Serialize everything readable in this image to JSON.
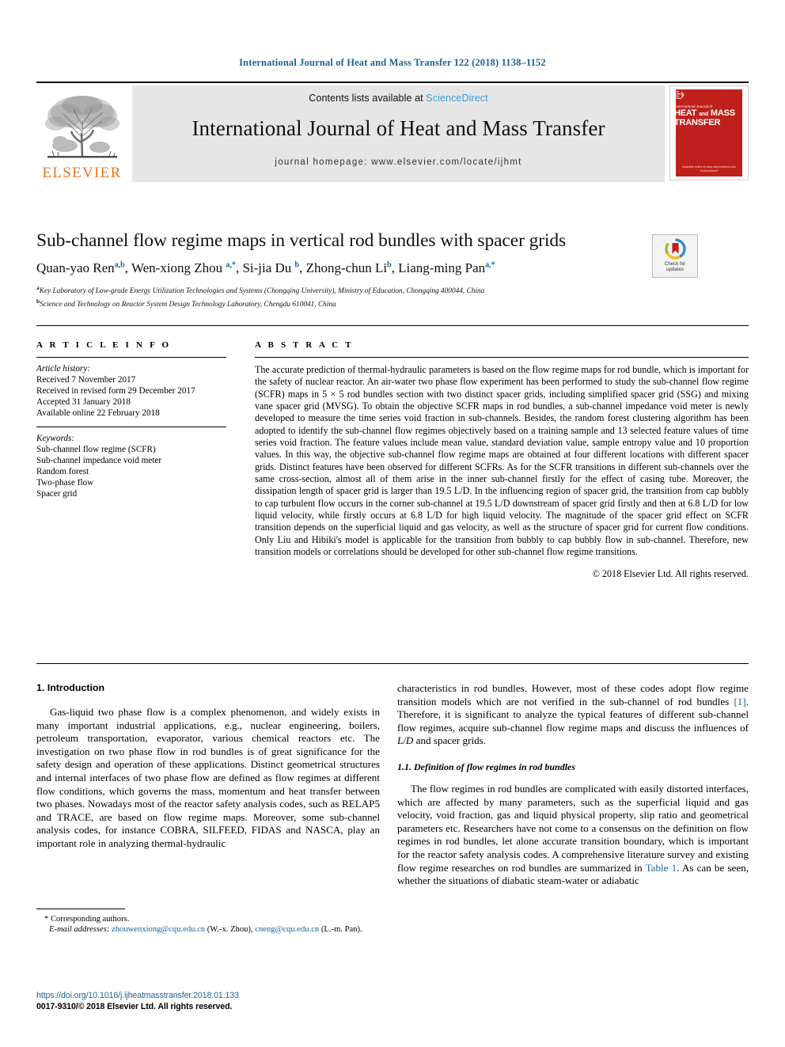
{
  "running_head": "International Journal of Heat and Mass Transfer 122 (2018) 1138–1152",
  "masthead": {
    "contents_prefix": "Contents lists available at ",
    "sciencedirect": "ScienceDirect",
    "journal_title": "International Journal of Heat and Mass Transfer",
    "journal_homepage": "journal homepage: www.elsevier.com/locate/ijhmt",
    "publisher": "ELSEVIER",
    "cover": {
      "line_small": "International Journal of",
      "line_big_1": "HEAT",
      "line_big_and": "and",
      "line_big_2": "MASS",
      "line_big_3": "TRANSFER",
      "footer_1": "Available online at www.sciencedirect.com",
      "footer_2": "ScienceDirect"
    },
    "accent_blue": "#3A9FD6",
    "elsevier_orange": "#E87722",
    "cover_red": "#c0201c"
  },
  "article": {
    "title": "Sub-channel flow regime maps in vertical rod bundles with spacer grids",
    "authors": [
      {
        "name": "Quan-yao Ren",
        "sup": "a,b"
      },
      {
        "name": "Wen-xiong Zhou",
        "sup": "a,*"
      },
      {
        "name": "Si-jia Du",
        "sup": "b"
      },
      {
        "name": "Zhong-chun Li",
        "sup": "b"
      },
      {
        "name": "Liang-ming Pan",
        "sup": "a,*"
      }
    ],
    "affiliations": [
      {
        "marker": "a",
        "text": "Key Laboratory of Low-grade Energy Utilization Technologies and Systems (Chongqing University), Ministry of Education, Chongqing 400044, China"
      },
      {
        "marker": "b",
        "text": "Science and Technology on Reactor System Design Technology Laboratory, Chengdu 610041, China"
      }
    ],
    "crossmark_label_line1": "Check for",
    "crossmark_label_line2": "updates"
  },
  "article_info": {
    "heading": "A R T I C L E   I N F O",
    "history_heading": "Article history:",
    "history": [
      "Received 7 November 2017",
      "Received in revised form 29 December 2017",
      "Accepted 31 January 2018",
      "Available online 22 February 2018"
    ],
    "keywords_heading": "Keywords:",
    "keywords": [
      "Sub-channel flow regime (SCFR)",
      "Sub-channel impedance void meter",
      "Random forest",
      "Two-phase flow",
      "Spacer grid"
    ]
  },
  "abstract": {
    "heading": "A B S T R A C T",
    "text": "The accurate prediction of thermal-hydraulic parameters is based on the flow regime maps for rod bundle, which is important for the safety of nuclear reactor. An air-water two phase flow experiment has been performed to study the sub-channel flow regime (SCFR) maps in 5 × 5 rod bundles section with two distinct spacer grids, including simplified spacer grid (SSG) and mixing vane spacer grid (MVSG). To obtain the objective SCFR maps in rod bundles, a sub-channel impedance void meter is newly developed to measure the time series void fraction in sub-channels. Besides, the random forest clustering algorithm has been adopted to identify the sub-channel flow regimes objectively based on a training sample and 13 selected feature values of time series void fraction. The feature values include mean value, standard deviation value, sample entropy value and 10 proportion values. In this way, the objective sub-channel flow regime maps are obtained at four different locations with different spacer grids. Distinct features have been observed for different SCFRs. As for the SCFR transitions in different sub-channels over the same cross-section, almost all of them arise in the inner sub-channel firstly for the effect of casing tube. Moreover, the dissipation length of spacer grid is larger than 19.5 L/D. In the influencing region of spacer grid, the transition from cap bubbly to cap turbulent flow occurs in the corner sub-channel at 19.5 L/D downstream of spacer grid firstly and then at 6.8 L/D for low liquid velocity, while firstly occurs at 6.8 L/D for high liquid velocity. The magnitude of the spacer grid effect on SCFR transition depends on the superficial liquid and gas velocity, as well as the structure of spacer grid for current flow conditions. Only Liu and Hibiki's model is applicable for the transition from bubbly to cap bubbly flow in sub-channel. Therefore, new transition models or correlations should be developed for other sub-channel flow regime transitions.",
    "copyright": "© 2018 Elsevier Ltd. All rights reserved."
  },
  "body": {
    "section1_heading": "1. Introduction",
    "section1_para1_left": "Gas-liquid two phase flow is a complex phenomenon, and widely exists in many important industrial applications, e.g., nuclear engineering, boilers, petroleum transportation, evaporator, various chemical reactors etc. The investigation on two phase flow in rod bundles is of great significance for the safety design and operation of these applications. Distinct geometrical structures and internal interfaces of two phase flow are defined as flow regimes at different flow conditions, which governs the mass, momentum and heat transfer between two phases. Nowadays most of the reactor safety analysis codes, such as RELAP5 and TRACE, are based on flow regime maps. Moreover, some sub-channel analysis codes, for instance COBRA, SILFEED, FIDAS and NASCA, play an important role in analyzing thermal-hydraulic",
    "section1_para1_right_a": "characteristics in rod bundles. However, most of these codes adopt flow regime transition models which are not verified in the sub-channel of rod bundles ",
    "ref_1": "[1]",
    "section1_para1_right_b": ". Therefore, it is significant to analyze the typical features of different sub-channel flow regimes, acquire sub-channel flow regime maps and discuss the influences of ",
    "ld_italic": "L/D",
    "section1_para1_right_c": " and spacer grids.",
    "section11_heading": "1.1. Definition of flow regimes in rod bundles",
    "section11_para_a": "The flow regimes in rod bundles are complicated with easily distorted interfaces, which are affected by many parameters, such as the superficial liquid and gas velocity, void fraction, gas and liquid physical property, slip ratio and geometrical parameters etc. Researchers have not come to a consensus on the definition on flow regimes in rod bundles, let alone accurate transition boundary, which is important for the reactor safety analysis codes. A comprehensive literature survey and existing flow regime researches on rod bundles are summarized in ",
    "table_1_link": "Table 1",
    "section11_para_b": ". As can be seen, whether the situations of diabatic steam-water or adiabatic"
  },
  "footnote": {
    "corresponding": "* Corresponding authors.",
    "email_label": "E-mail addresses:",
    "email_1": "zhouwenxiong@cqu.edu.cn",
    "email_1_owner": "(W.-x. Zhou),",
    "email_2": "cneng@cqu.edu.cn",
    "email_2_owner": "(L.-m. Pan)."
  },
  "footer": {
    "doi": "https://doi.org/10.1016/j.ijheatmasstransfer.2018.01.133",
    "issn": "0017-9310/© 2018 Elsevier Ltd. All rights reserved."
  }
}
